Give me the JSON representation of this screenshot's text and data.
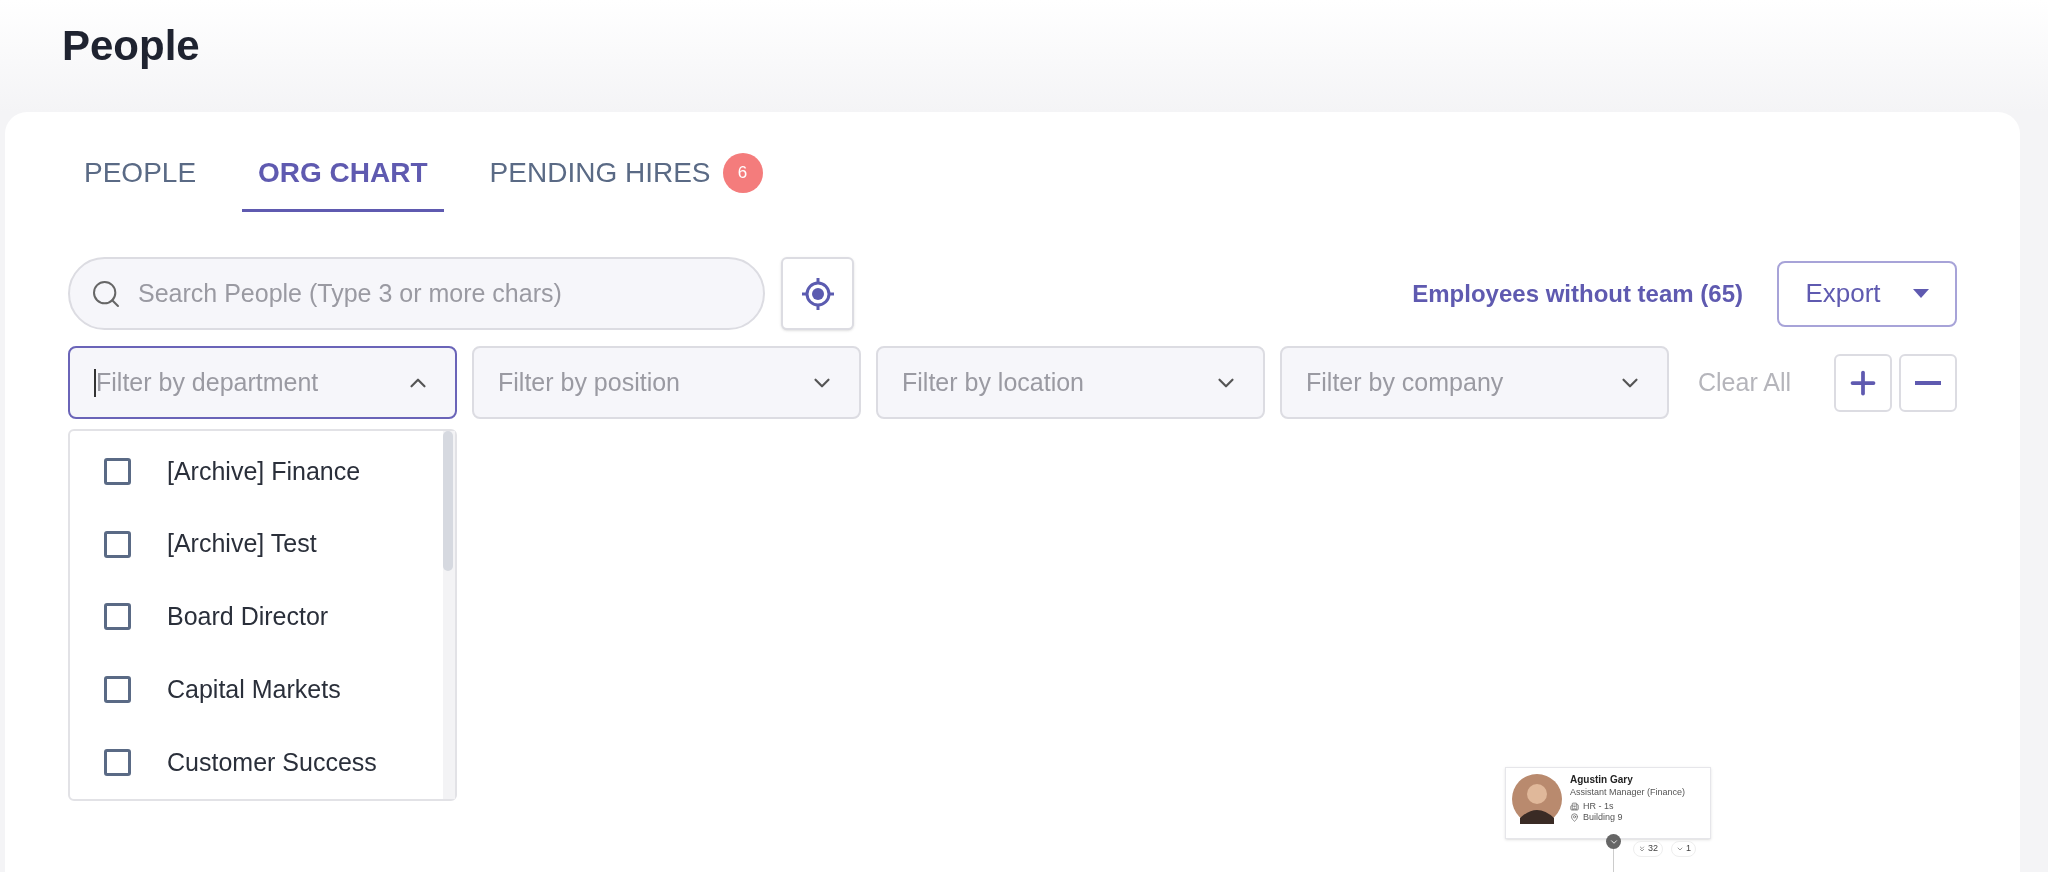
{
  "page_title": "People",
  "tabs": [
    {
      "label": "PEOPLE",
      "selected": false
    },
    {
      "label": "ORG CHART",
      "selected": true
    },
    {
      "label": "PENDING HIRES",
      "selected": false,
      "badge": "6"
    }
  ],
  "search": {
    "placeholder": "Search People (Type 3 or more chars)"
  },
  "employees_without_team": "Employees without team (65)",
  "export_button": "Export",
  "filters": [
    {
      "placeholder": "Filter by department",
      "expanded": true
    },
    {
      "placeholder": "Filter by position",
      "expanded": false
    },
    {
      "placeholder": "Filter by location",
      "expanded": false
    },
    {
      "placeholder": "Filter by company",
      "expanded": false
    }
  ],
  "clear_all": "Clear All",
  "department_options": [
    {
      "label": "[Archive] Finance",
      "checked": false
    },
    {
      "label": "[Archive] Test",
      "checked": false
    },
    {
      "label": "Board Director",
      "checked": false
    },
    {
      "label": "Capital Markets",
      "checked": false
    },
    {
      "label": "Customer Success",
      "checked": false
    }
  ],
  "org_node": {
    "name": "Agustin Gary",
    "title": "Assistant Manager (Finance)",
    "department": "HR - 1s",
    "location": "Building 9",
    "reports_count": "32",
    "direct_count": "1"
  }
}
